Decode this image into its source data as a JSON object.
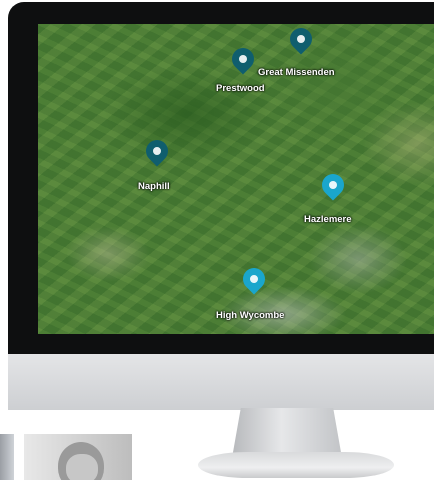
{
  "map": {
    "locations": [
      {
        "name": "Great Missenden",
        "pin": "dark"
      },
      {
        "name": "Prestwood",
        "pin": "dark"
      },
      {
        "name": "Naphill",
        "pin": "dark"
      },
      {
        "name": "Hazlemere",
        "pin": "light"
      },
      {
        "name": "High Wycombe",
        "pin": "light"
      }
    ]
  },
  "colors": {
    "pin_dark": "#0f5e6e",
    "pin_light": "#1aa6cc",
    "monitor_bezel": "#0e0f10"
  },
  "icons": [
    "map-pin-icon"
  ]
}
